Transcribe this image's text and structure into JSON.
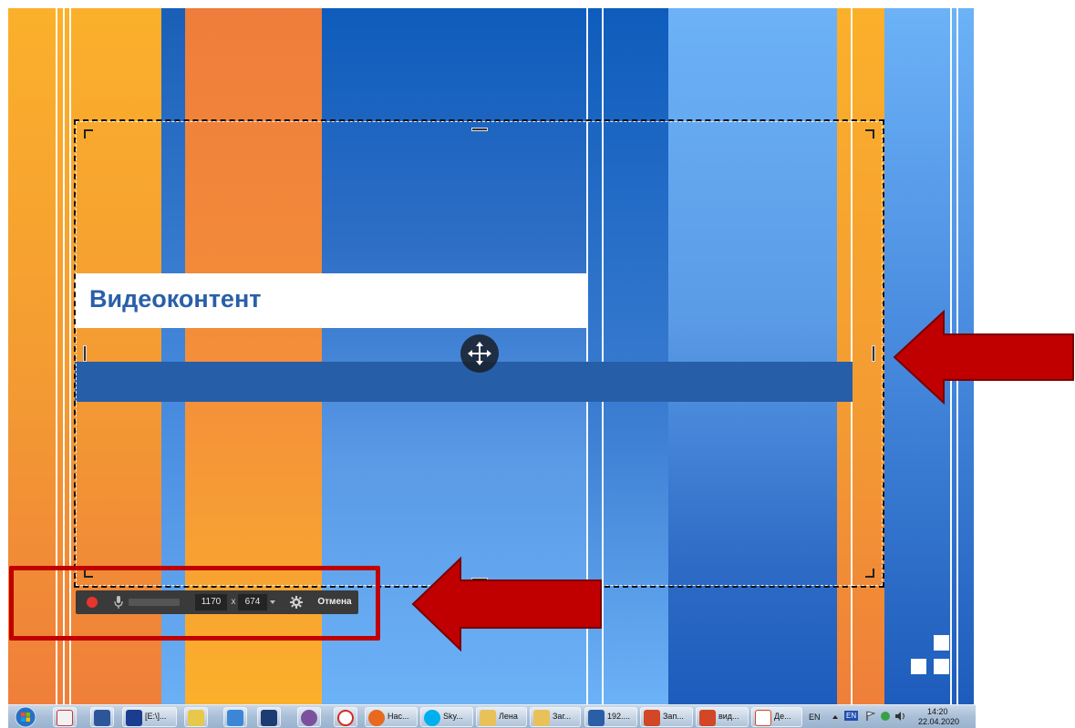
{
  "slide": {
    "title": "Видеоконтент"
  },
  "capture": {
    "width_value": "1170",
    "height_value": "674",
    "separator": "x",
    "cancel_label": "Отмена"
  },
  "colors": {
    "highlight": "#c00000",
    "record": "#e9342f",
    "toolbar": "#3a3a3a",
    "title_text": "#2a5fa8"
  },
  "taskbar": {
    "items": [
      {
        "label": "",
        "icon": "yandex-browser-icon"
      },
      {
        "label": "",
        "icon": "word-icon"
      },
      {
        "label": "[E:\\]...",
        "icon": "file-manager-icon"
      },
      {
        "label": "",
        "icon": "paint-icon"
      },
      {
        "label": "",
        "icon": "network-icon"
      },
      {
        "label": "",
        "icon": "virtualbox-icon"
      },
      {
        "label": "",
        "icon": "viber-icon"
      },
      {
        "label": "",
        "icon": "yandex-icon"
      },
      {
        "label": "Нас...",
        "icon": "firefox-icon"
      },
      {
        "label": "Sky...",
        "icon": "skype-icon"
      },
      {
        "label": "Лена",
        "icon": "folder-icon"
      },
      {
        "label": "Заг...",
        "icon": "folder-icon"
      },
      {
        "label": "192....",
        "icon": "remote-desktop-icon"
      },
      {
        "label": "Зап...",
        "icon": "powerpoint-icon"
      },
      {
        "label": "вид...",
        "icon": "powerpoint-icon"
      },
      {
        "label": "Де...",
        "icon": "powerpoint-doc-icon"
      }
    ],
    "tray": {
      "lang": "EN",
      "lang_badge": "EN",
      "time": "14:20",
      "date": "22.04.2020"
    }
  }
}
